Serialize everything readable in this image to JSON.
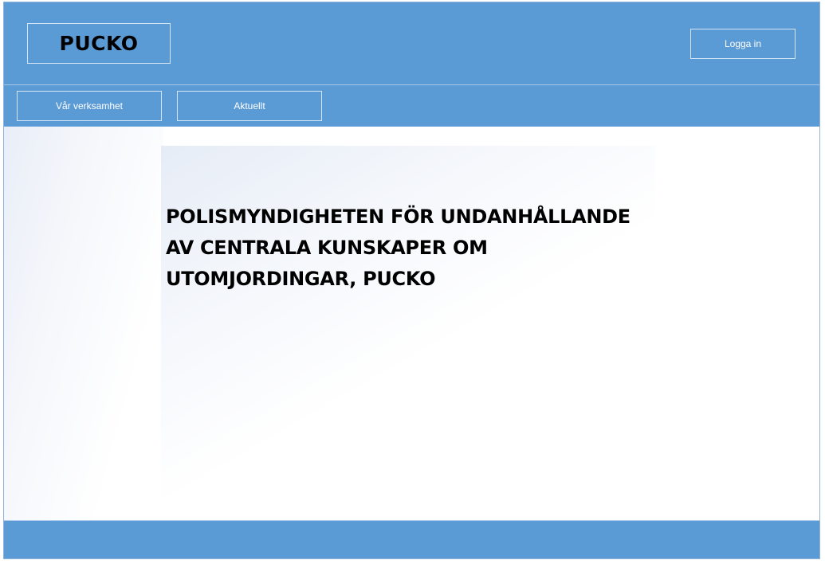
{
  "header": {
    "logo_text": "PUCKO",
    "login_label": "Logga in"
  },
  "nav": {
    "items": [
      {
        "label": "Vår verksamhet"
      },
      {
        "label": "Aktuellt"
      }
    ]
  },
  "main": {
    "headline_lines": [
      "POLISMYNDIGHETEN FÖR UNDANHÅLLANDE",
      "AV CENTRALA KUNSKAPER OM",
      "UTOMJORDINGAR, PUCKO"
    ]
  },
  "colors": {
    "brand_blue": "#5b9bd5",
    "text": "#000000"
  }
}
